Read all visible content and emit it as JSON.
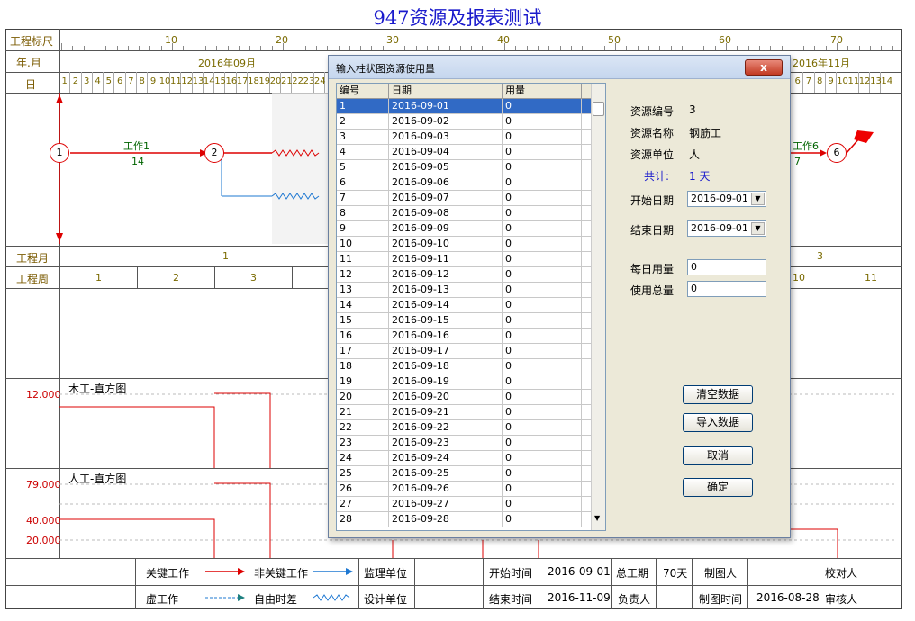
{
  "title": "947资源及报表测试",
  "ruler": {
    "label_scale": "工程标尺",
    "label_month": "年.月",
    "label_day": "日",
    "scale_marks": [
      "10",
      "20",
      "30",
      "40",
      "50",
      "60",
      "70"
    ],
    "month_left": "2016年09月",
    "month_right": "2016年11月",
    "days_left": [
      "1",
      "2",
      "3",
      "4",
      "5",
      "6",
      "7",
      "8",
      "9",
      "10",
      "11",
      "12",
      "13",
      "14",
      "15",
      "16",
      "17",
      "18",
      "19",
      "20",
      "21",
      "22",
      "23",
      "24"
    ],
    "days_right": [
      "6",
      "7",
      "8",
      "9",
      "10",
      "11",
      "12",
      "13",
      "14"
    ]
  },
  "network": {
    "nodes": [
      "1",
      "2",
      "6"
    ],
    "work1_name": "工作1",
    "work1_dur": "14",
    "work6_name": "工作6",
    "work6_dur": "7"
  },
  "project_month": {
    "label": "工程月",
    "left": "1",
    "right": "3"
  },
  "project_week": {
    "label": "工程周",
    "left": [
      "1",
      "2",
      "3"
    ],
    "right": [
      "10",
      "11"
    ]
  },
  "hist1": {
    "title": "木工-直方图",
    "value": "12.000"
  },
  "hist2": {
    "title": "人工-直方图",
    "values": [
      "79.000",
      "40.000",
      "20.000"
    ]
  },
  "footer": {
    "legend_critical": "关键工作",
    "legend_noncritical": "非关键工作",
    "legend_dummy": "虚工作",
    "legend_free": "自由时差",
    "supervisor": "监理单位",
    "design": "设计单位",
    "start_label": "开始时间",
    "start_value": "2016-09-01",
    "end_label": "结束时间",
    "end_value": "2016-11-09",
    "duration_label": "总工期",
    "duration_value": "70天",
    "owner_label": "负责人",
    "drawer_label": "制图人",
    "draw_time_label": "制图时间",
    "draw_time_value": "2016-08-28",
    "checker_label": "校对人",
    "reviewer_label": "审核人"
  },
  "dialog": {
    "title": "输入柱状图资源使用量",
    "close": "x",
    "columns": [
      "编号",
      "日期",
      "用量"
    ],
    "rows": [
      [
        "1",
        "2016-09-01",
        "0"
      ],
      [
        "2",
        "2016-09-02",
        "0"
      ],
      [
        "3",
        "2016-09-03",
        "0"
      ],
      [
        "4",
        "2016-09-04",
        "0"
      ],
      [
        "5",
        "2016-09-05",
        "0"
      ],
      [
        "6",
        "2016-09-06",
        "0"
      ],
      [
        "7",
        "2016-09-07",
        "0"
      ],
      [
        "8",
        "2016-09-08",
        "0"
      ],
      [
        "9",
        "2016-09-09",
        "0"
      ],
      [
        "10",
        "2016-09-10",
        "0"
      ],
      [
        "11",
        "2016-09-11",
        "0"
      ],
      [
        "12",
        "2016-09-12",
        "0"
      ],
      [
        "13",
        "2016-09-13",
        "0"
      ],
      [
        "14",
        "2016-09-14",
        "0"
      ],
      [
        "15",
        "2016-09-15",
        "0"
      ],
      [
        "16",
        "2016-09-16",
        "0"
      ],
      [
        "17",
        "2016-09-17",
        "0"
      ],
      [
        "18",
        "2016-09-18",
        "0"
      ],
      [
        "19",
        "2016-09-19",
        "0"
      ],
      [
        "20",
        "2016-09-20",
        "0"
      ],
      [
        "21",
        "2016-09-21",
        "0"
      ],
      [
        "22",
        "2016-09-22",
        "0"
      ],
      [
        "23",
        "2016-09-23",
        "0"
      ],
      [
        "24",
        "2016-09-24",
        "0"
      ],
      [
        "25",
        "2016-09-25",
        "0"
      ],
      [
        "26",
        "2016-09-26",
        "0"
      ],
      [
        "27",
        "2016-09-27",
        "0"
      ],
      [
        "28",
        "2016-09-28",
        "0"
      ]
    ],
    "resource_id_label": "资源编号",
    "resource_id": "3",
    "resource_name_label": "资源名称",
    "resource_name": "钢筋工",
    "resource_unit_label": "资源单位",
    "resource_unit": "人",
    "total_label": "共计:",
    "total_value": "1 天",
    "start_date_label": "开始日期",
    "start_date": "2016-09-01",
    "end_date_label": "结束日期",
    "end_date": "2016-09-01",
    "daily_label": "每日用量",
    "daily_value": "0",
    "total_use_label": "使用总量",
    "total_use_value": "0",
    "btn_clear": "清空数据",
    "btn_import": "导入数据",
    "btn_cancel": "取消",
    "btn_ok": "确定"
  }
}
